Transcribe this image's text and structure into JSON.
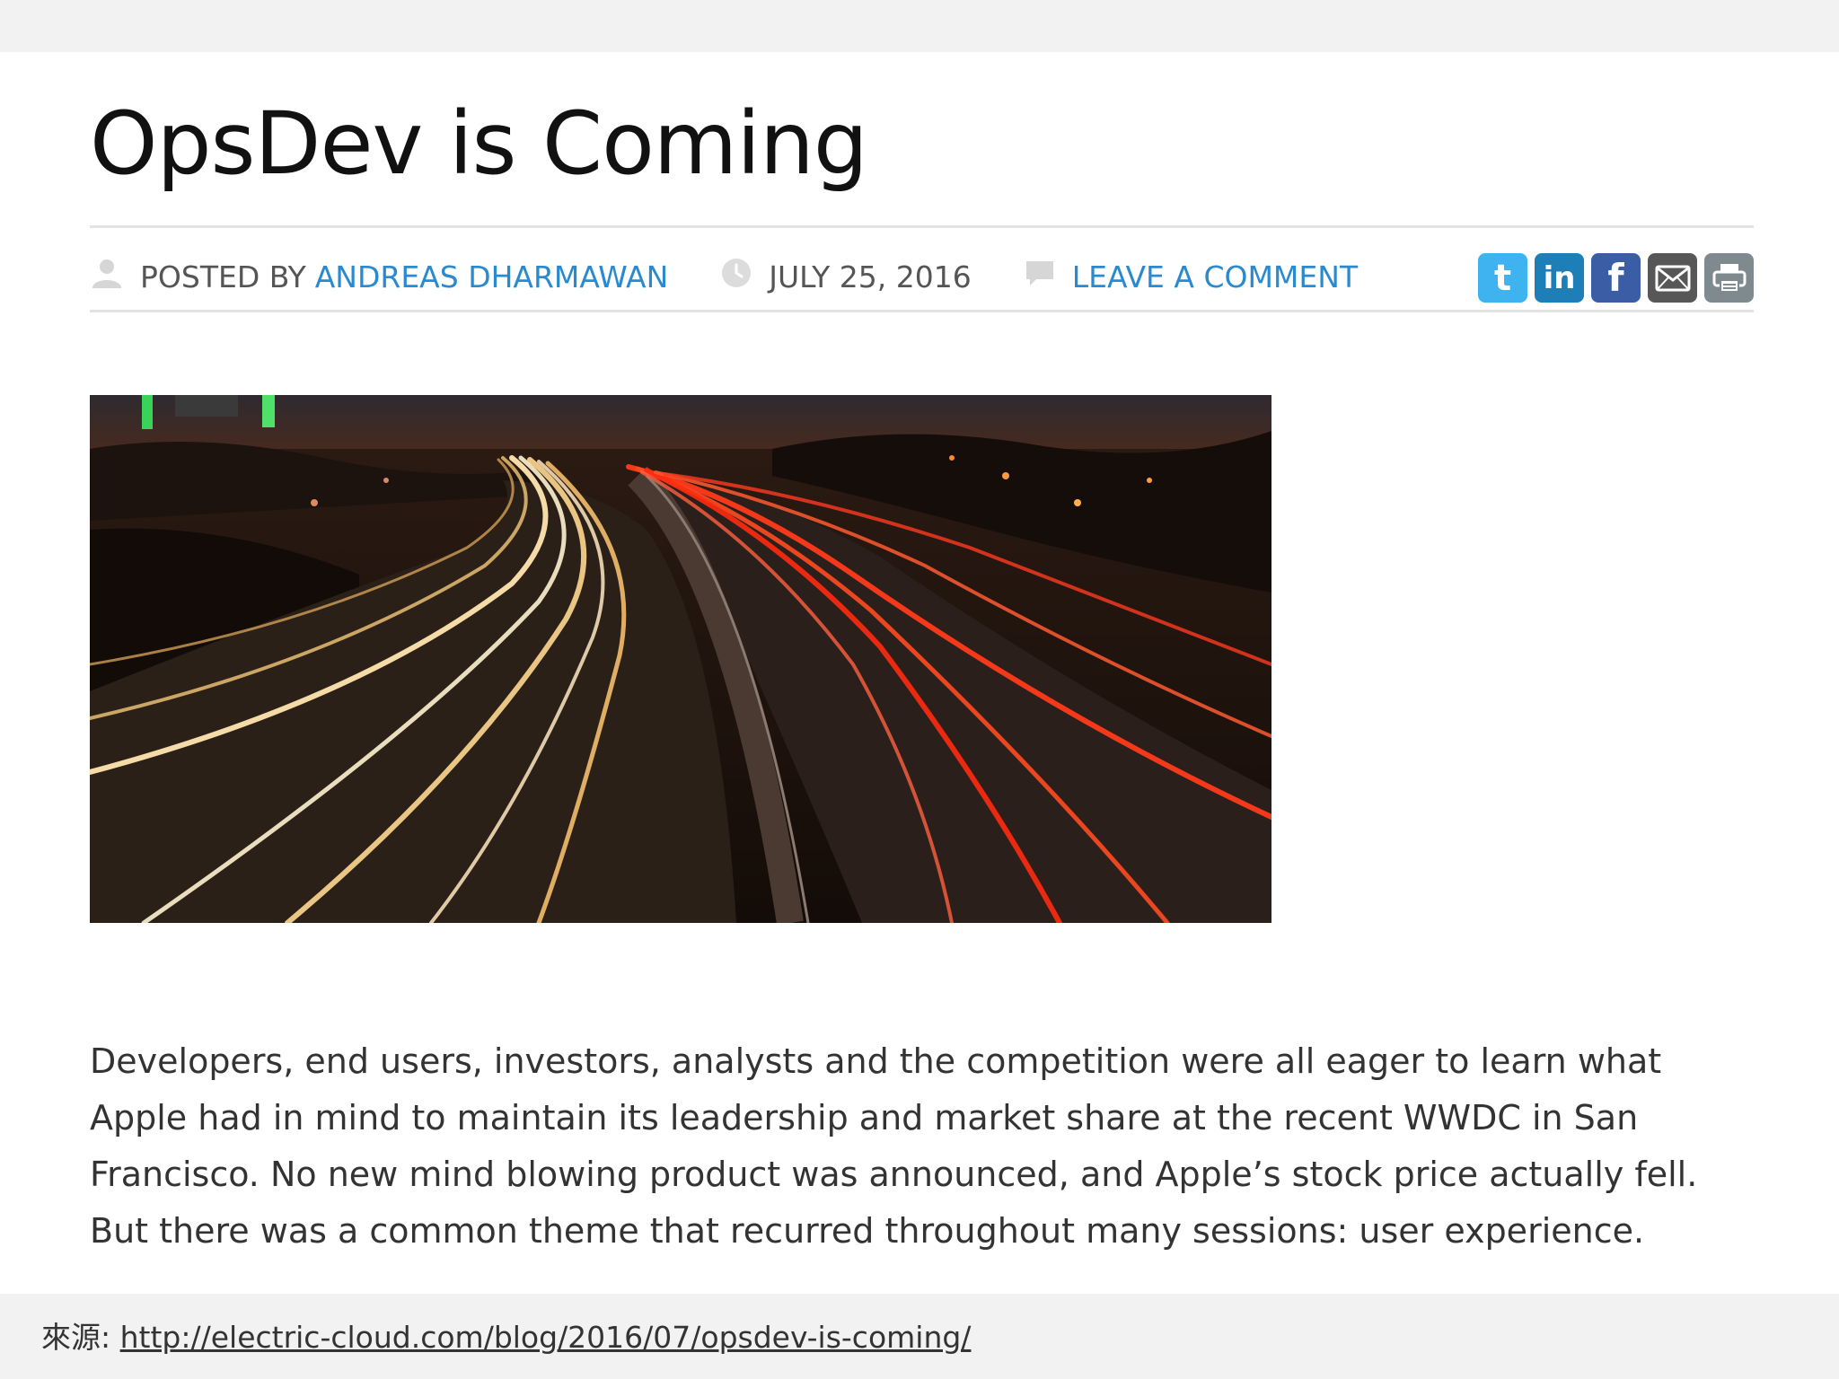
{
  "article": {
    "title": "OpsDev is Coming",
    "meta": {
      "posted_by_label": "POSTED BY",
      "author": "ANDREAS DHARMAWAN",
      "date": "JULY 25, 2016",
      "comment_link": "LEAVE A COMMENT"
    },
    "share_icons": [
      "twitter-icon",
      "linkedin-icon",
      "facebook-icon",
      "email-icon",
      "print-icon"
    ],
    "share_glyphs": {
      "twitter": "t",
      "linkedin": "in",
      "facebook": "f"
    },
    "body": "Developers, end users, investors, analysts and the competition were all eager to learn what Apple had in mind to maintain its leadership and market share at the recent WWDC in San Francisco. No new mind blowing product was announced, and Apple’s stock price actually fell. But there was a common theme that recurred throughout many sessions: user experience."
  },
  "source": {
    "label": "來源:",
    "url": "http://electric-cloud.com/blog/2016/07/opsdev-is-coming/"
  },
  "colors": {
    "link": "#2a8ad0",
    "twitter": "#3fb3ef",
    "linkedin": "#1d7eb8",
    "facebook": "#3b5da5",
    "email": "#575757",
    "print": "#7f8a8f"
  }
}
